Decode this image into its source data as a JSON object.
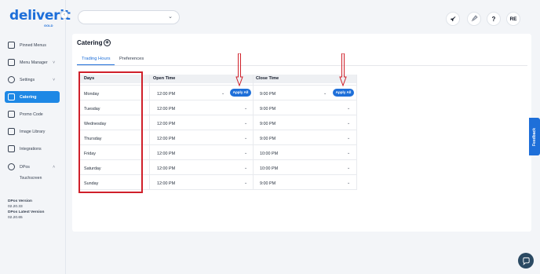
{
  "brand": {
    "name": "deliverit",
    "sub": "GOLD"
  },
  "sidebar": {
    "items": [
      {
        "label": "Pinned Menus",
        "icon": "pin-icon",
        "chevron": ""
      },
      {
        "label": "Menu Manager",
        "icon": "menu-icon",
        "chevron": "˅"
      },
      {
        "label": "Settings",
        "icon": "gear-icon",
        "chevron": "˅"
      },
      {
        "label": "Catering",
        "icon": "catering-icon",
        "chevron": ""
      },
      {
        "label": "Promo Code",
        "icon": "promo-icon",
        "chevron": ""
      },
      {
        "label": "Image Library",
        "icon": "image-icon",
        "chevron": ""
      },
      {
        "label": "Integrations",
        "icon": "integration-icon",
        "chevron": ""
      },
      {
        "label": "DPos",
        "icon": "pos-icon",
        "chevron": "˄"
      }
    ],
    "sub_item": "Touchscreen",
    "version_label": "DPos Version",
    "version": "02.20.33",
    "latest_label": "DPos Latest Version",
    "latest": "02.20.65"
  },
  "topbar": {
    "store_value": "",
    "avatar_initials": "RE",
    "help": "?"
  },
  "page": {
    "title": "Catering",
    "tabs": [
      "Trading Hours",
      "Preferences"
    ],
    "active_tab": "Trading Hours"
  },
  "table": {
    "headers": {
      "days": "Days",
      "open": "Open Time",
      "close": "Close Time"
    },
    "apply_label": "Apply All",
    "rows": [
      {
        "day": "Monday",
        "open": "12:00 PM",
        "close": "9:00 PM"
      },
      {
        "day": "Tuesday",
        "open": "12:00 PM",
        "close": "9:00 PM"
      },
      {
        "day": "Wednesday",
        "open": "12:00 PM",
        "close": "9:00 PM"
      },
      {
        "day": "Thursday",
        "open": "12:00 PM",
        "close": "9:00 PM"
      },
      {
        "day": "Friday",
        "open": "12:00 PM",
        "close": "10:00 PM"
      },
      {
        "day": "Saturday",
        "open": "12:00 PM",
        "close": "10:00 PM"
      },
      {
        "day": "Sunday",
        "open": "12:00 PM",
        "close": "9:00 PM"
      }
    ]
  },
  "feedback_label": "Feedback",
  "colors": {
    "accent": "#1e6fd9",
    "annotation": "#d0202a",
    "active_nav": "#1e88e5"
  }
}
